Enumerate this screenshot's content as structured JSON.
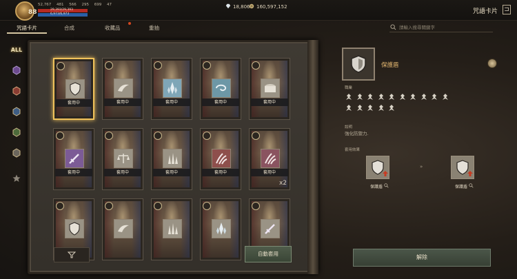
{
  "header": {
    "level": "88",
    "stats": [
      "52,767",
      "481",
      "566",
      "295",
      "699",
      "47"
    ],
    "hp_text": "29,393/29,393",
    "hp_fraction": 1.0,
    "mp_text": "6,973/6,973",
    "mp_fraction": 1.0,
    "diamonds": "18,806",
    "gold": "160,597,152",
    "window_title": "咒語卡片",
    "exit_icon": "exit-door-icon"
  },
  "tabs": [
    {
      "label": "咒語卡片",
      "active": true
    },
    {
      "label": "合成",
      "active": false
    },
    {
      "label": "收藏品",
      "active": false,
      "notification": true
    },
    {
      "label": "重抽",
      "active": false
    }
  ],
  "search": {
    "placeholder": "請輸入搜尋關鍵字"
  },
  "side_filter": [
    {
      "label": "ALL",
      "icon": "all-icon"
    },
    {
      "icon": "purple-rune-icon"
    },
    {
      "icon": "red-rune-icon"
    },
    {
      "icon": "blue-rune-icon"
    },
    {
      "icon": "green-rune-icon"
    },
    {
      "icon": "gray-rune-icon"
    },
    {
      "icon": "star-icon"
    }
  ],
  "cards": [
    {
      "label": "套用中",
      "emblem": "shield-icon",
      "color": "#9a9385"
    },
    {
      "label": "套用中",
      "emblem": "wings-icon",
      "color": "#9a9385"
    },
    {
      "label": "套用中",
      "emblem": "crystal-icon",
      "color": "#7fa6b7"
    },
    {
      "label": "套用中",
      "emblem": "swirl-icon",
      "color": "#6d97a6"
    },
    {
      "label": "套用中",
      "emblem": "chest-icon",
      "color": "#9a9385"
    },
    {
      "label": "套用中",
      "emblem": "sword-icon",
      "color": "#7c5b96"
    },
    {
      "label": "套用中",
      "emblem": "scales-icon",
      "color": "#9a9385"
    },
    {
      "label": "套用中",
      "emblem": "spikes-icon",
      "color": "#9a9385"
    },
    {
      "label": "套用中",
      "emblem": "claw-icon",
      "color": "#8e4f4c"
    },
    {
      "label": "套用中",
      "emblem": "claw-icon",
      "color": "#8a5360",
      "count": "x2"
    },
    {
      "emblem": "shield-icon",
      "color": "#9a9385"
    },
    {
      "emblem": "wings-icon",
      "color": "#9a9385"
    },
    {
      "emblem": "spikes-icon",
      "color": "#9a9385"
    },
    {
      "emblem": "crystal-icon",
      "color": "#9a9385"
    },
    {
      "emblem": "sword-icon",
      "color": "#9a9385"
    }
  ],
  "buttons": {
    "filter_icon": "filter-icon",
    "auto_apply": "自動套用",
    "release": "解除"
  },
  "detail": {
    "name": "保護盾",
    "class_label": "職業",
    "class_icon_count": 15,
    "desc_label": "說明",
    "description": "強化防禦力.",
    "effect_label": "套用效果",
    "effect_before": "保護盾",
    "effect_after": "保護盾",
    "arrow": "»"
  },
  "colors": {
    "accent_gold": "#f0c25b",
    "name_orange": "#e0b46f",
    "button_green": "#4b5649"
  }
}
